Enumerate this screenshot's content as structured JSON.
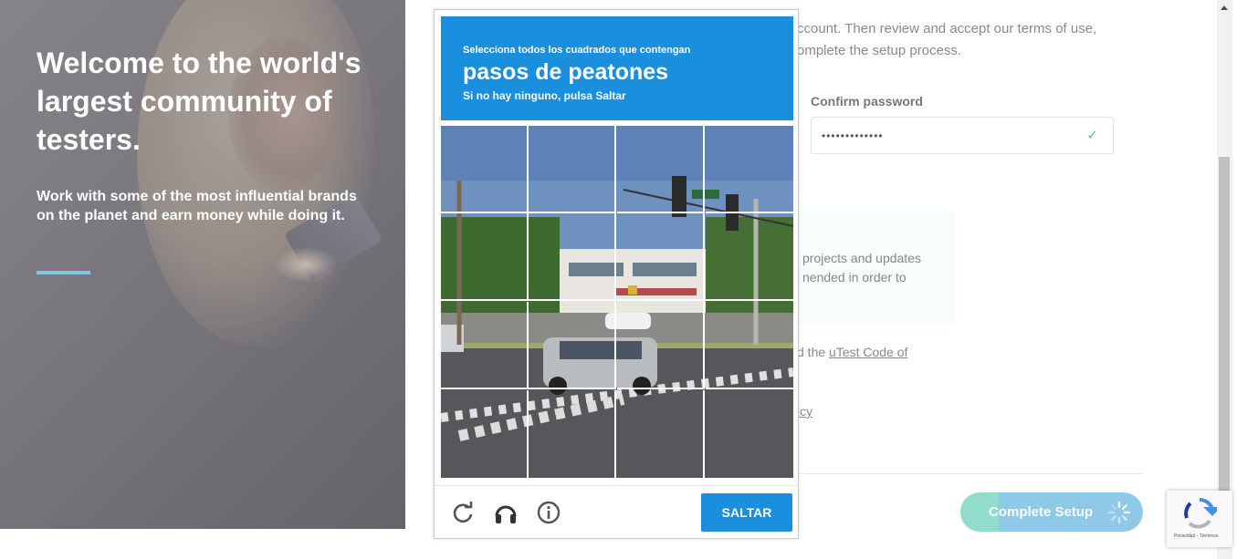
{
  "hero": {
    "headline": "Welcome to the world's largest community of testers.",
    "subtext": "Work with some of the most influential brands on the planet and earn money while doing it."
  },
  "form": {
    "intro_text": "ccount. Then review and accept our terms of use, omplete the setup process.",
    "confirm_password_label": "Confirm password",
    "confirm_password_value": "•••••••••••••",
    "notice_text": "projects and updates nended in order to",
    "code_prefix": "d the ",
    "code_link": "uTest Code of",
    "policy_link": "icy",
    "complete_setup_label": "Complete Setup"
  },
  "captcha": {
    "instruction": "Selecciona todos los cuadrados que contengan",
    "target": "pasos de peatones",
    "hint": "Si no hay ninguno, pulsa Saltar",
    "skip_label": "SALTAR",
    "icons": [
      "reload-icon",
      "audio-icon",
      "info-icon"
    ]
  },
  "recaptcha_badge": {
    "links": "Privacidad - Términos"
  },
  "colors": {
    "captcha_blue": "#1a8fde",
    "accent_teal": "#7fd7c4",
    "accent_blue": "#7cc0e6",
    "hero_accent": "#7cc7e8"
  }
}
